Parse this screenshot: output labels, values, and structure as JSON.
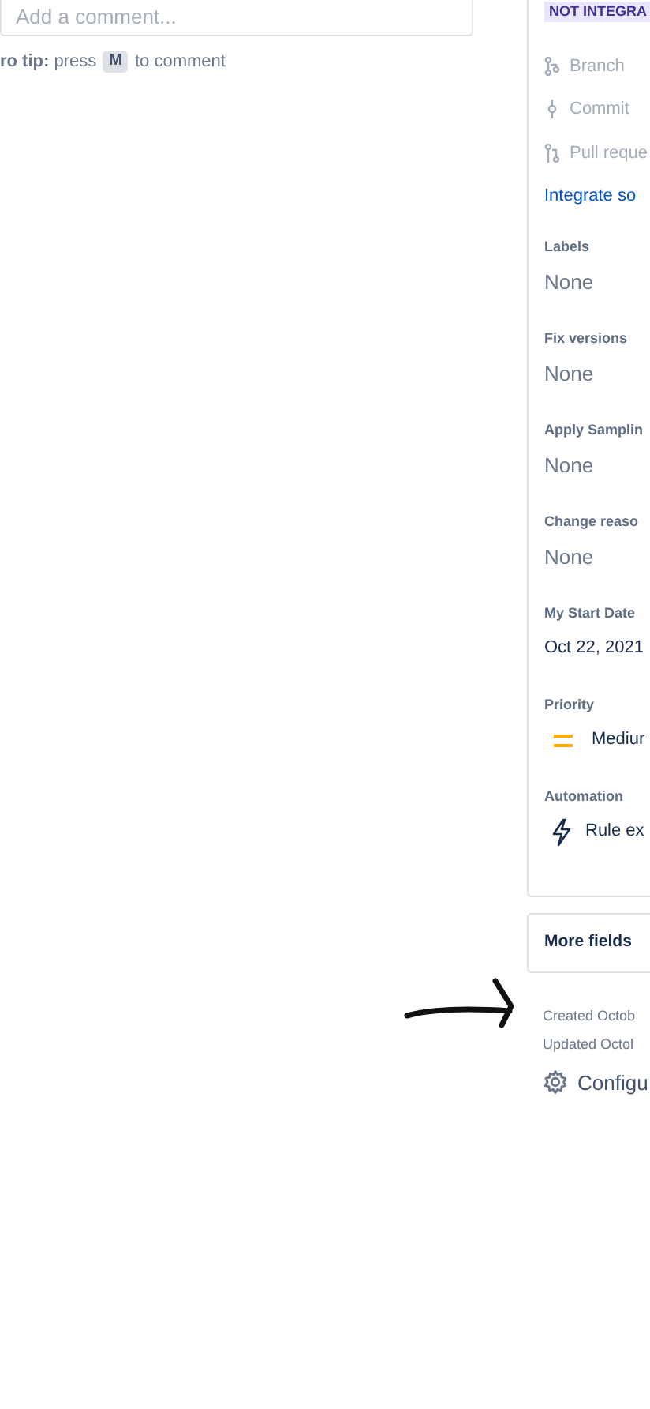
{
  "comment": {
    "placeholder": "Add a comment...",
    "tip": "**ro tip:** press",
    "tip_key": "M",
    "tip_end": "to comment"
  },
  "development": {
    "badge": "NOT INTEGRA",
    "items": [
      {
        "kind": "branch",
        "label": "Branch"
      },
      {
        "kind": "commit",
        "label": "Commit"
      },
      {
        "kind": "pull",
        "label": "Pull reque"
      }
    ],
    "link": "Integrate so"
  },
  "fields": [
    {
      "label": "Labels",
      "value": "None",
      "kind": "empty"
    },
    {
      "label": "Fix versions",
      "value": "None",
      "kind": "empty"
    },
    {
      "label": "Apply Samplin",
      "value": "None",
      "kind": "empty"
    },
    {
      "label": "Change reaso",
      "value": "None",
      "kind": "empty"
    },
    {
      "label": "My Start Date",
      "value": "Oct 22, 2021",
      "kind": "date"
    },
    {
      "label": "Priority",
      "value": "Mediur",
      "kind": "priority"
    },
    {
      "label": "Automation",
      "value": "Rule ex",
      "kind": "automation"
    }
  ],
  "more_fields": "More fields",
  "created": "Created Octob",
  "updated": "Updated Octol",
  "configure": "Configu"
}
